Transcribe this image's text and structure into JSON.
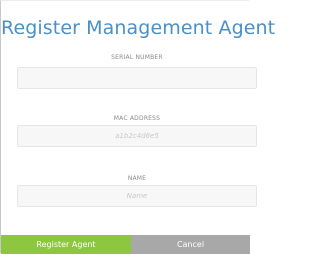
{
  "dialog": {
    "title": "Register Management Agent",
    "fields": {
      "serial": {
        "label": "SERIAL NUMBER",
        "value": "",
        "placeholder": ""
      },
      "mac": {
        "label": "MAC ADDRESS",
        "value": "",
        "placeholder": "a1b2c4d6e5"
      },
      "name": {
        "label": "NAME",
        "value": "",
        "placeholder": "Name"
      }
    },
    "buttons": {
      "register": "Register Agent",
      "cancel": "Cancel"
    }
  },
  "colors": {
    "title": "#4a90c8",
    "primary_button": "#8dc63f",
    "secondary_button": "#a8a8a8"
  }
}
